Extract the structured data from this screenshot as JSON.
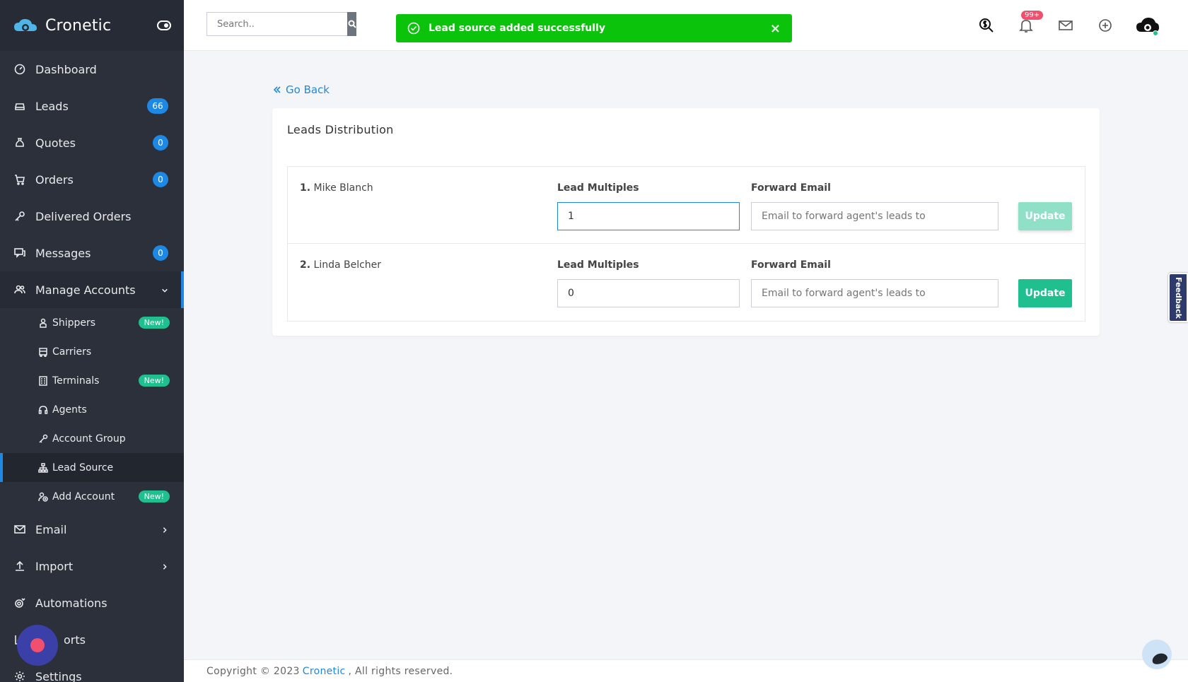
{
  "brand": {
    "name": "Cronetic"
  },
  "nav": {
    "dashboard": "Dashboard",
    "leads": "Leads",
    "leads_count": "66",
    "quotes": "Quotes",
    "quotes_count": "0",
    "orders": "Orders",
    "orders_count": "0",
    "delivered": "Delivered Orders",
    "messages": "Messages",
    "messages_count": "0",
    "manage_accounts": "Manage Accounts",
    "email": "Email",
    "import": "Import",
    "automations": "Automations",
    "reports": "orts",
    "settings": "Settings"
  },
  "subnav": {
    "shippers": "Shippers",
    "carriers": "Carriers",
    "terminals": "Terminals",
    "agents": "Agents",
    "account_group": "Account Group",
    "lead_source": "Lead Source",
    "add_account": "Add Account",
    "new_badge": "New!"
  },
  "search": {
    "placeholder": "Search.."
  },
  "toast": {
    "message": "Lead source added successfully",
    "close": "×"
  },
  "notifications": {
    "count": "99+"
  },
  "goback": {
    "label": "Go Back"
  },
  "card": {
    "title": "Leads Distribution",
    "rows": [
      {
        "num": "1.",
        "name": "Mike Blanch",
        "mult_label": "Lead Multiples",
        "mult_value": "1",
        "fwd_label": "Forward Email",
        "fwd_placeholder": "Email to forward agent's leads to",
        "button": "Update"
      },
      {
        "num": "2.",
        "name": "Linda Belcher",
        "mult_label": "Lead Multiples",
        "mult_value": "0",
        "fwd_label": "Forward Email",
        "fwd_placeholder": "Email to forward agent's leads to",
        "button": "Update"
      }
    ]
  },
  "feedback": {
    "label": "Feedback"
  },
  "footer": {
    "prefix": "Copyright © 2023",
    "link": "Cronetic",
    "suffix": ", All rights reserved."
  },
  "colors": {
    "accent": "#1e88e5",
    "success": "#0bc30b",
    "update": "#1fbf8f",
    "sidebar": "#2b303b"
  }
}
